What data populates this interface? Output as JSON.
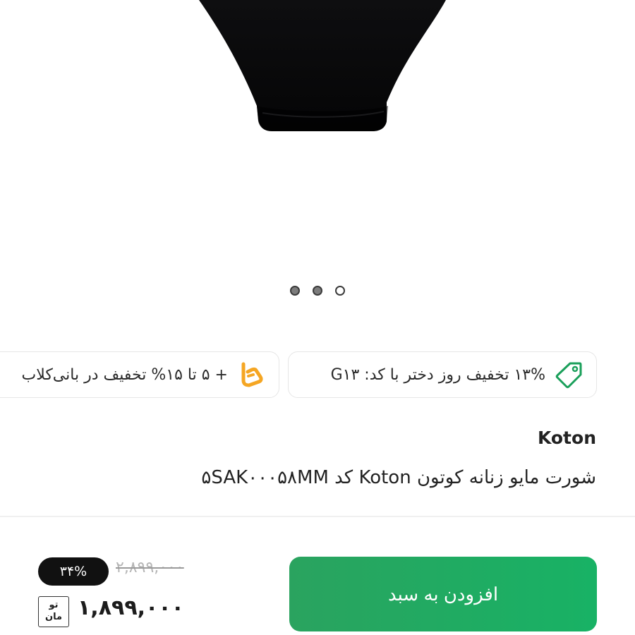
{
  "carousel": {
    "slides": [
      {
        "state": "inactive"
      },
      {
        "state": "inactive"
      },
      {
        "state": "active"
      }
    ]
  },
  "promos": [
    {
      "icon": "tag-icon",
      "text": "۱۳% تخفیف روز دختر با کد: G۱۳",
      "icon_color": "#1a9f5a"
    },
    {
      "icon": "club-logo-icon",
      "text": "+ ۵ تا ۱۵% تخفیف در بانی‌کلاب",
      "icon_color": "#f5a623"
    }
  ],
  "product": {
    "brand": "Koton",
    "title": "شورت مایو زنانه کوتون Koton کد ۵SAK۰۰۰۵۸MM"
  },
  "cart": {
    "add_label": "افزودن به سبد",
    "button_color": "#1fab60"
  },
  "price": {
    "discount": "۳۴%",
    "old": "۲,۸۹۹,۰۰۰",
    "current": "۱,۸۹۹,۰۰۰",
    "currency_line1": "تو",
    "currency_line2": "مان"
  }
}
